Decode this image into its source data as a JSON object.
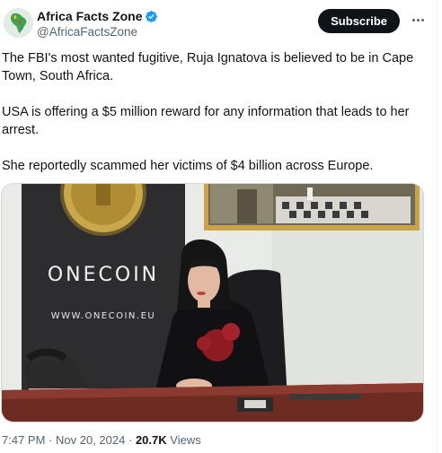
{
  "author": {
    "display_name": "Africa Facts Zone",
    "handle": "@AfricaFactsZone",
    "verified": true,
    "avatar_icon": "africa-logo-icon"
  },
  "actions": {
    "subscribe_label": "Subscribe",
    "more_icon": "more-horizontal-icon"
  },
  "tweet": {
    "paragraphs": [
      "The FBI's most wanted fugitive, Ruja Ignatova is believed to be in Cape Town, South Africa.",
      "USA is offering a $5 million reward for any information that leads to her arrest.",
      "She reportedly scammed her victims of $4 billion across Europe."
    ]
  },
  "media": {
    "banner_title": "ONECOIN",
    "banner_url": "WWW.ONECOIN.EU"
  },
  "meta": {
    "time": "7:47 PM",
    "separator": "·",
    "date": "Nov 20, 2024",
    "views_count": "20.7K",
    "views_label": "Views"
  },
  "colors": {
    "text_primary": "#0f1419",
    "text_secondary": "#536471",
    "verified_blue": "#1d9bf0",
    "subscribe_bg": "#0f1419"
  }
}
